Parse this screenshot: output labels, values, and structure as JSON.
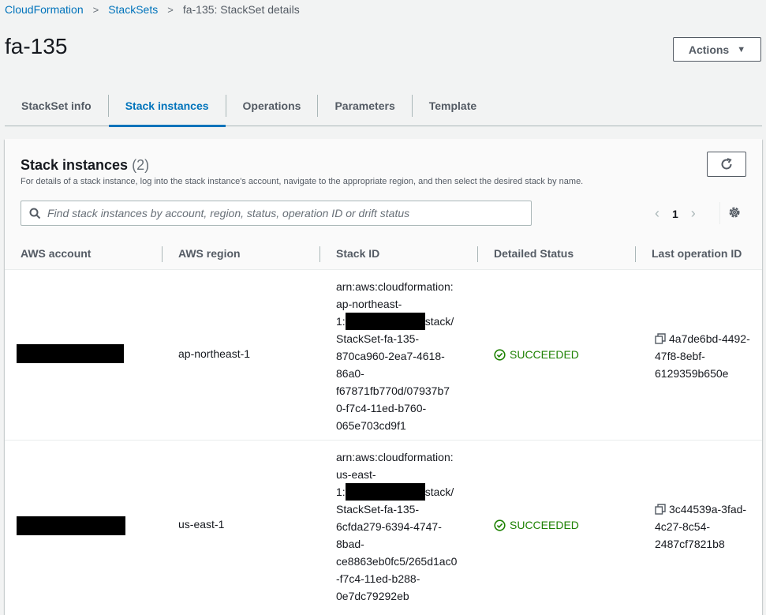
{
  "breadcrumb": {
    "items": [
      "CloudFormation",
      "StackSets"
    ],
    "current": "fa-135: StackSet details"
  },
  "page": {
    "title": "fa-135",
    "actions_label": "Actions"
  },
  "tabs": [
    {
      "label": "StackSet info"
    },
    {
      "label": "Stack instances"
    },
    {
      "label": "Operations"
    },
    {
      "label": "Parameters"
    },
    {
      "label": "Template"
    }
  ],
  "active_tab": "Stack instances",
  "panel": {
    "title": "Stack instances",
    "count": "(2)",
    "description": "For details of a stack instance, log into the stack instance's account, navigate to the appropriate region, and then select the desired stack by name.",
    "search_placeholder": "Find stack instances by account, region, status, operation ID or drift status",
    "page_number": "1"
  },
  "table": {
    "columns": [
      "AWS account",
      "AWS region",
      "Stack ID",
      "Detailed Status",
      "Last operation ID"
    ],
    "rows": [
      {
        "account": "",
        "region": "ap-northeast-1",
        "stack_id": {
          "l1": "arn:aws:cloudformation:",
          "l2": "ap-northeast-",
          "l3_pre": "1:",
          "l3_post": "stack/",
          "l4": "StackSet-fa-135-",
          "l5": "870ca960-2ea7-4618-",
          "l6": "86a0-",
          "l7": "f67871fb770d/07937b7",
          "l8": "0-f7c4-11ed-b760-",
          "l9": "065e703cd9f1"
        },
        "status": "SUCCEEDED",
        "op_id": {
          "l1": "4a7de6bd-4492-",
          "l2": "47f8-8ebf-",
          "l3": "6129359b650e"
        }
      },
      {
        "account": "",
        "region": "us-east-1",
        "stack_id": {
          "l1": "arn:aws:cloudformation:",
          "l2": "us-east-",
          "l3_pre": "1:",
          "l3_post": "stack/",
          "l4": "StackSet-fa-135-",
          "l5": "6cfda279-6394-4747-",
          "l6": "8bad-",
          "l7": "ce8863eb0fc5/265d1ac0",
          "l8": "-f7c4-11ed-b288-",
          "l9": "0e7dc79292eb"
        },
        "status": "SUCCEEDED",
        "op_id": {
          "l1": "3c44539a-3fad-",
          "l2": "4c27-8c54-",
          "l3": "2487cf7821b8"
        }
      }
    ]
  },
  "colors": {
    "link": "#0073bb",
    "success": "#1d8102",
    "text": "#16191f",
    "muted": "#545b64"
  },
  "icons": [
    "chevron-right-icon",
    "caret-down-icon",
    "refresh-icon",
    "search-icon",
    "chevron-left-icon",
    "chevron-right-icon",
    "settings-icon",
    "success-check-icon",
    "copy-icon"
  ]
}
